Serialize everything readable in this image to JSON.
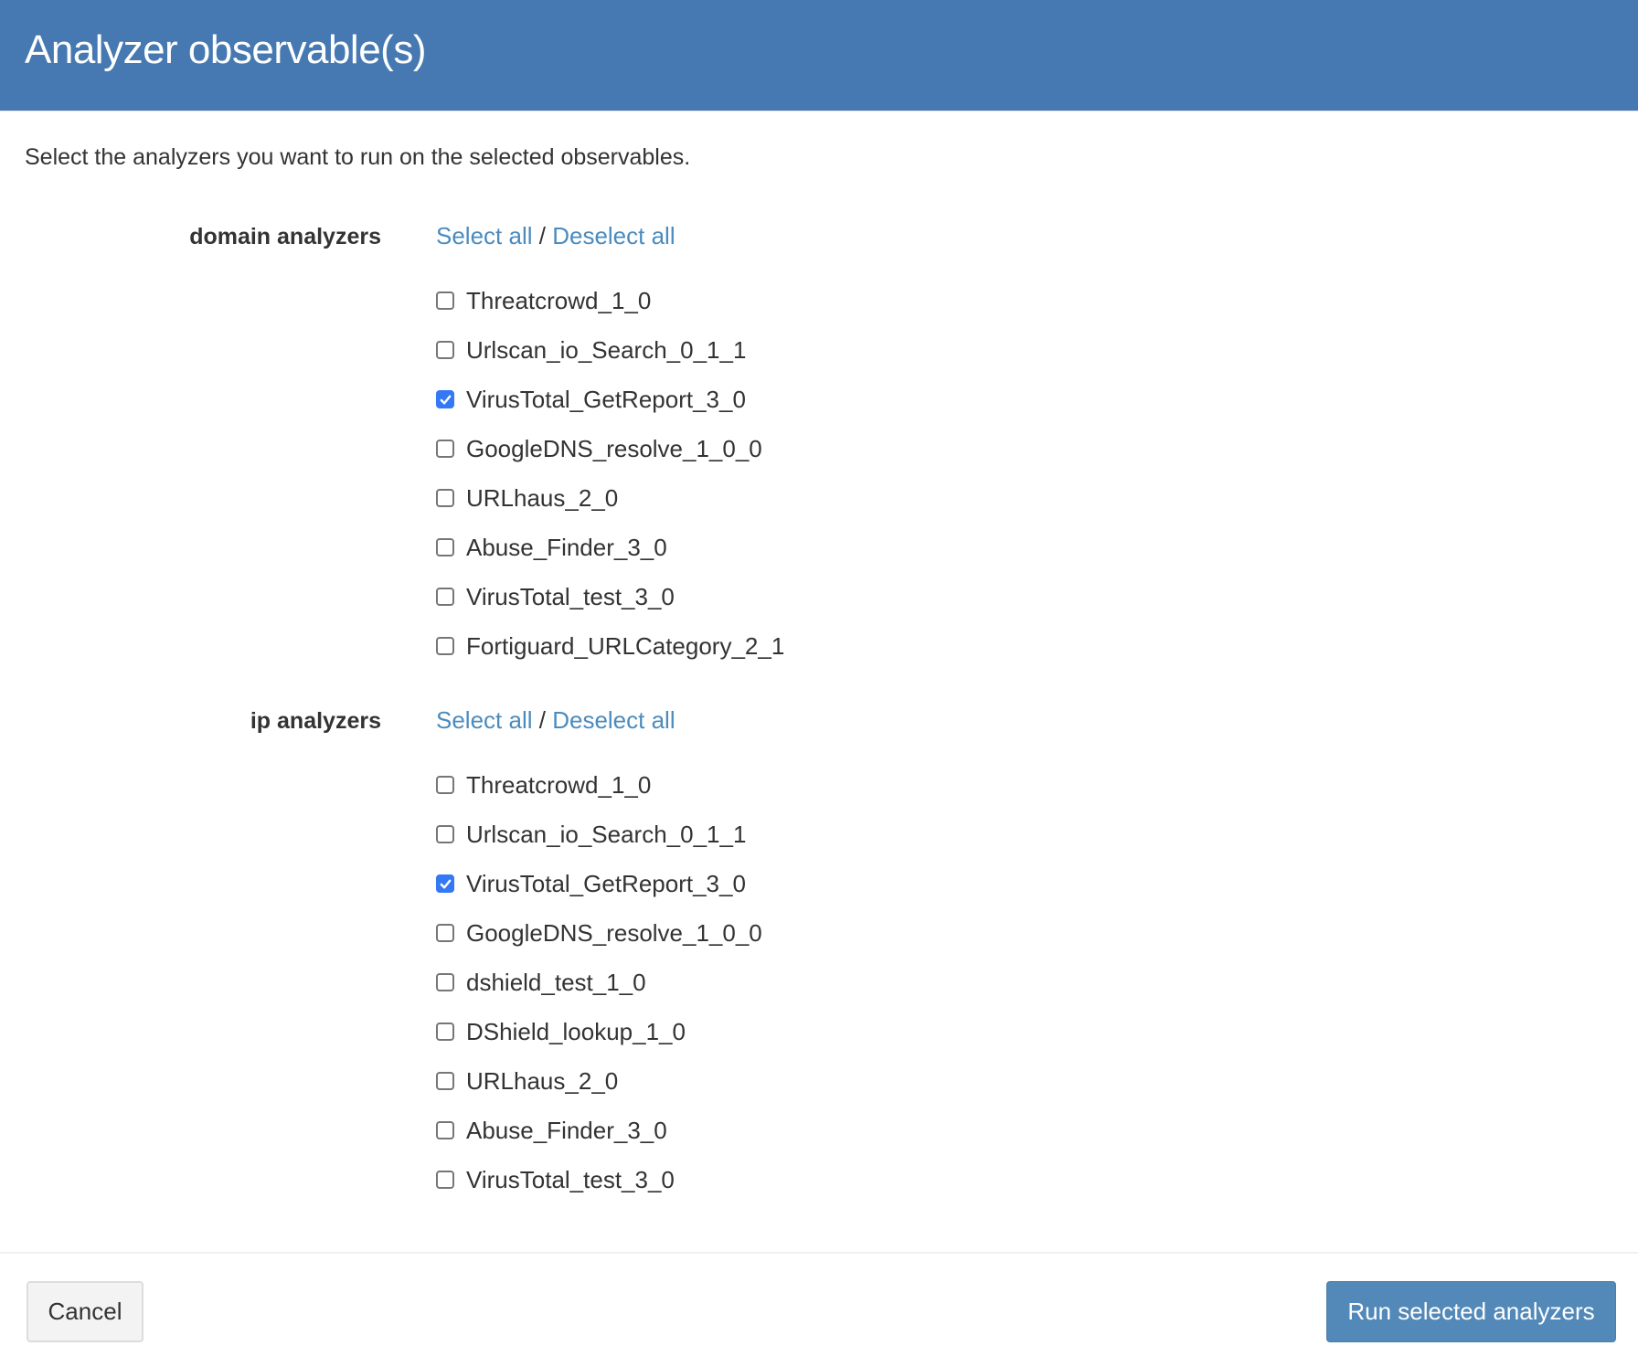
{
  "modal": {
    "title": "Analyzer observable(s)",
    "intro": "Select the analyzers you want to run on the selected observables.",
    "select_all_label": "Select all",
    "separator": "/",
    "deselect_all_label": "Deselect all"
  },
  "sections": [
    {
      "label": "domain analyzers",
      "items": [
        {
          "name": "Threatcrowd_1_0",
          "checked": false
        },
        {
          "name": "Urlscan_io_Search_0_1_1",
          "checked": false
        },
        {
          "name": "VirusTotal_GetReport_3_0",
          "checked": true
        },
        {
          "name": "GoogleDNS_resolve_1_0_0",
          "checked": false
        },
        {
          "name": "URLhaus_2_0",
          "checked": false
        },
        {
          "name": "Abuse_Finder_3_0",
          "checked": false
        },
        {
          "name": "VirusTotal_test_3_0",
          "checked": false
        },
        {
          "name": "Fortiguard_URLCategory_2_1",
          "checked": false
        }
      ]
    },
    {
      "label": "ip analyzers",
      "items": [
        {
          "name": "Threatcrowd_1_0",
          "checked": false
        },
        {
          "name": "Urlscan_io_Search_0_1_1",
          "checked": false
        },
        {
          "name": "VirusTotal_GetReport_3_0",
          "checked": true
        },
        {
          "name": "GoogleDNS_resolve_1_0_0",
          "checked": false
        },
        {
          "name": "dshield_test_1_0",
          "checked": false
        },
        {
          "name": "DShield_lookup_1_0",
          "checked": false
        },
        {
          "name": "URLhaus_2_0",
          "checked": false
        },
        {
          "name": "Abuse_Finder_3_0",
          "checked": false
        },
        {
          "name": "VirusTotal_test_3_0",
          "checked": false
        }
      ]
    }
  ],
  "footer": {
    "cancel_label": "Cancel",
    "run_label": "Run selected analyzers"
  },
  "colors": {
    "header_bg": "#4679b1",
    "link": "#4b8bbe",
    "checkbox_checked": "#3478f6",
    "primary_button": "#5289b8"
  }
}
